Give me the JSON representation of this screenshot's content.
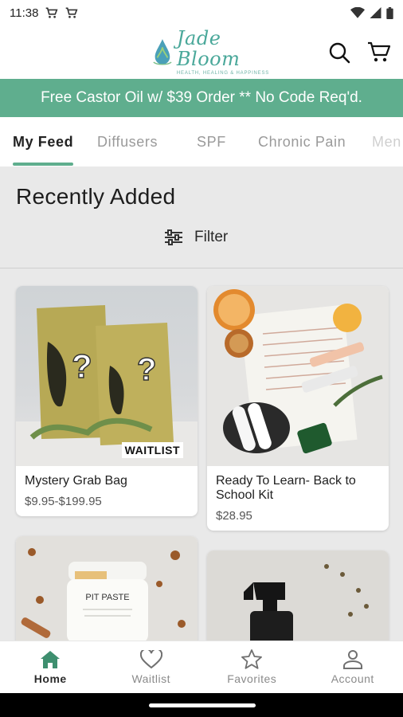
{
  "status_bar": {
    "time": "11:38",
    "left_icons": [
      "cart-icon",
      "cart-icon"
    ],
    "right_icons": [
      "wifi-icon",
      "signal-icon",
      "battery-icon"
    ]
  },
  "header": {
    "logo_name": "Jade Bloom",
    "logo_tagline": "HEALTH, HEALING & HAPPINESS",
    "icons": [
      "search-icon",
      "cart-icon"
    ]
  },
  "promo": {
    "text": "Free Castor Oil w/ $39 Order ** No Code Req'd."
  },
  "tabs": [
    {
      "label": "My Feed",
      "active": true
    },
    {
      "label": "Diffusers",
      "active": false
    },
    {
      "label": "SPF",
      "active": false
    },
    {
      "label": "Chronic Pain",
      "active": false
    },
    {
      "label": "Men",
      "active": false
    }
  ],
  "main": {
    "section_title": "Recently Added",
    "filter_label": "Filter"
  },
  "products": [
    {
      "title": "Mystery Grab Bag",
      "price": "$9.95-$199.95",
      "badge": "WAITLIST"
    },
    {
      "title": "Ready To Learn- Back to School Kit",
      "price": "$28.95"
    },
    {
      "image_text": "PIT PASTE"
    },
    {
      "image_text": ""
    }
  ],
  "bottom_nav": [
    {
      "label": "Home",
      "icon": "home-icon",
      "active": true
    },
    {
      "label": "Waitlist",
      "icon": "heart-icon",
      "active": false
    },
    {
      "label": "Favorites",
      "icon": "star-icon",
      "active": false
    },
    {
      "label": "Account",
      "icon": "person-icon",
      "active": false
    }
  ],
  "colors": {
    "accent": "#5fae8e",
    "brand_text": "#4aa89a"
  }
}
